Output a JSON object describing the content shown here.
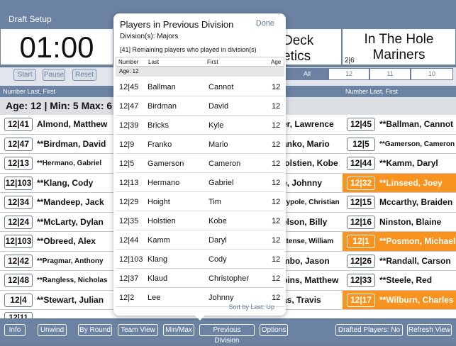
{
  "app": {
    "title": "Draft Setup"
  },
  "timer": "01:00",
  "on_deck": {
    "line1": "Deck",
    "line2": "etics"
  },
  "in_the_hole": {
    "line1": "In The Hole",
    "line2": "Mariners",
    "pick": "2|6"
  },
  "controls": {
    "start": "Start",
    "pause": "Pause",
    "reset": "Reset"
  },
  "segments": [
    "All",
    "12",
    "11",
    "10"
  ],
  "headers": {
    "left": "Number Last, First",
    "right": "Number Last, First"
  },
  "age_line": "Age: 12 | Min: 5 Max: 6 |",
  "left_list": [
    {
      "pick": "12|41",
      "name": "Almond, Matthew",
      "small": false,
      "orange": false
    },
    {
      "pick": "12|47",
      "name": "**Birdman, David",
      "small": false,
      "orange": false
    },
    {
      "pick": "12|13",
      "name": "**Hermano, Gabriel",
      "small": true,
      "orange": false
    },
    {
      "pick": "12|103",
      "name": "**Klang, Cody",
      "small": false,
      "orange": false
    },
    {
      "pick": "12|34",
      "name": "**Mandeep, Jack",
      "small": false,
      "orange": false
    },
    {
      "pick": "12|24",
      "name": "**McLarty, Dylan",
      "small": false,
      "orange": false
    },
    {
      "pick": "12|103",
      "name": "**Obreed, Alex",
      "small": false,
      "orange": false
    },
    {
      "pick": "12|42",
      "name": "**Pragmar, Anthony",
      "small": true,
      "orange": false
    },
    {
      "pick": "12|48",
      "name": "**Rangless, Nicholas",
      "small": true,
      "orange": false
    },
    {
      "pick": "12|4",
      "name": "**Stewart, Julian",
      "small": false,
      "orange": false
    }
  ],
  "middle_list": [
    {
      "name": "er, Lawrence",
      "small": false
    },
    {
      "name": "anko, Mario",
      "small": false
    },
    {
      "name": "lolstien, Kobe",
      "small": false
    },
    {
      "name": "e, Johnny",
      "small": false
    },
    {
      "name": "vypole, Christian",
      "small": true
    },
    {
      "name": "elson, Billy",
      "small": false
    },
    {
      "name": "atense, William",
      "small": true
    },
    {
      "name": "mbo, Jason",
      "small": false
    },
    {
      "name": "bins, Matthew",
      "small": false
    },
    {
      "name": "as, Travis",
      "small": false
    }
  ],
  "right_list": [
    {
      "pick": "12|45",
      "name": "**Ballman, Cannot",
      "small": false,
      "orange": false
    },
    {
      "pick": "12|5",
      "name": "**Gamerson, Cameron",
      "small": true,
      "orange": false
    },
    {
      "pick": "12|44",
      "name": "**Kamm, Daryl",
      "small": false,
      "orange": false
    },
    {
      "pick": "12|32",
      "name": "**Linseed, Joey",
      "small": false,
      "orange": true
    },
    {
      "pick": "12|15",
      "name": "Mccarthy, Braiden",
      "small": false,
      "orange": false
    },
    {
      "pick": "12|16",
      "name": "Ninston, Blaine",
      "small": false,
      "orange": false
    },
    {
      "pick": "12|1",
      "name": "**Posmon, Michael",
      "small": false,
      "orange": true
    },
    {
      "pick": "12|26",
      "name": "**Randall, Carson",
      "small": false,
      "orange": false
    },
    {
      "pick": "12|33",
      "name": "**Steele, Red",
      "small": false,
      "orange": false
    },
    {
      "pick": "12|17",
      "name": "**Wilburn, Charles",
      "small": false,
      "orange": true
    }
  ],
  "partial_pick": "12|11",
  "bottom": {
    "info": "Info",
    "unwind": "Unwind",
    "by_round": "By Round",
    "team_view": "Team View",
    "min_max": "Min/Max",
    "previous_division": "Previous Division",
    "options": "Options",
    "drafted_players": "Drafted Players: No",
    "refresh_view": "Refresh View"
  },
  "modal": {
    "title": "Players in Previous Division",
    "done": "Done",
    "divisions": "Division(s): Majors",
    "remaining": "[41] Remaining players who played in division(s)",
    "columns": {
      "number": "Number",
      "last": "Last",
      "first": "First",
      "age": "Age"
    },
    "age_group": "Age: 12",
    "rows": [
      {
        "number": "12|45",
        "last": "Ballman",
        "first": "Cannot",
        "age": "12"
      },
      {
        "number": "12|47",
        "last": "Birdman",
        "first": "David",
        "age": "12"
      },
      {
        "number": "12|39",
        "last": "Bricks",
        "first": "Kyle",
        "age": "12"
      },
      {
        "number": "12|9",
        "last": "Franko",
        "first": "Mario",
        "age": "12"
      },
      {
        "number": "12|5",
        "last": "Gamerson",
        "first": "Cameron",
        "age": "12"
      },
      {
        "number": "12|13",
        "last": "Hermano",
        "first": "Gabriel",
        "age": "12"
      },
      {
        "number": "12|29",
        "last": "Hoight",
        "first": "Tim",
        "age": "12"
      },
      {
        "number": "12|35",
        "last": "Holstien",
        "first": "Kobe",
        "age": "12"
      },
      {
        "number": "12|44",
        "last": "Kamm",
        "first": "Daryl",
        "age": "12"
      },
      {
        "number": "12|103",
        "last": "Klang",
        "first": "Cody",
        "age": "12"
      },
      {
        "number": "12|37",
        "last": "Klaud",
        "first": "Christopher",
        "age": "12"
      },
      {
        "number": "12|2",
        "last": "Lee",
        "first": "Johnny",
        "age": "12"
      }
    ],
    "sort": "Sort by Last: Up"
  }
}
